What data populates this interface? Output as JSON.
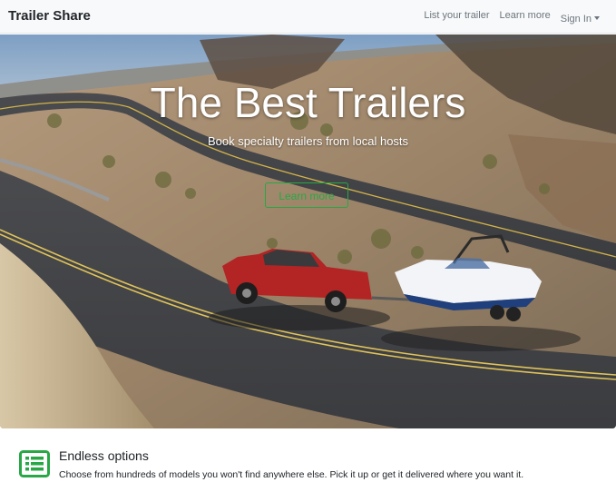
{
  "navbar": {
    "brand": "Trailer Share",
    "links": [
      {
        "label": "List your trailer"
      },
      {
        "label": "Learn more"
      },
      {
        "label": "Sign In"
      }
    ]
  },
  "hero": {
    "title": "The Best Trailers",
    "subtitle": "Book specialty trailers from local hosts",
    "button_label": "Learn more"
  },
  "feature": {
    "icon": "list-icon",
    "title": "Endless options",
    "description": "Choose from hundreds of models you won't find anywhere else. Pick it up or get it delivered where you want it."
  },
  "colors": {
    "accent": "#28a745",
    "navbar_bg": "#f8f9fa",
    "link": "#6c757d"
  }
}
